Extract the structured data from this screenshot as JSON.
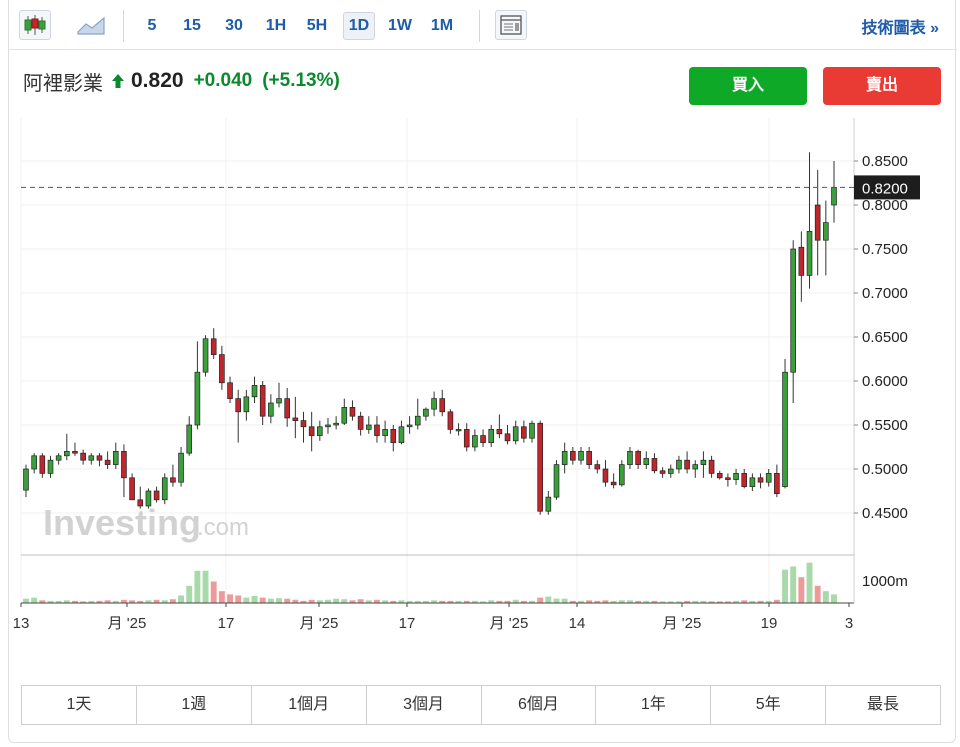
{
  "toolbar": {
    "candlestick_icon": "candlestick-icon",
    "area_icon": "area-chart-icon",
    "intervals": [
      "5",
      "15",
      "30",
      "1H",
      "5H",
      "1D",
      "1W",
      "1M"
    ],
    "active_interval": "1D",
    "layout_icon": "layout-icon",
    "tech_chart_label": "技術圖表 »"
  },
  "instrument": {
    "name": "阿裡影業",
    "price": "0.820",
    "change": "+0.040",
    "change_pct": "(+5.13%)",
    "up_color": "#0a8a2c"
  },
  "actions": {
    "buy_label": "買入",
    "sell_label": "賣出",
    "buy_color": "#0ea926",
    "sell_color": "#ea3a34"
  },
  "chart_data": {
    "type": "candlestick",
    "watermark_main": "Investing",
    "watermark_sub": ".com",
    "y_ticks": [
      "0.8500",
      "0.8000",
      "0.7500",
      "0.7000",
      "0.6500",
      "0.6000",
      "0.5500",
      "0.5000",
      "0.4500"
    ],
    "ylim": [
      0.43,
      0.9
    ],
    "current_price_label": "0.8200",
    "current_price": 0.82,
    "volume_tick_label": "1000m",
    "x_labels": [
      "13",
      "月 '25",
      "17",
      "月 '25",
      "17",
      "月 '25",
      "14",
      "月 '25",
      "19",
      "3"
    ],
    "up_color": "#3aa03a",
    "down_color": "#c0272d",
    "candles": [
      [
        0.476,
        0.505,
        0.468,
        0.5
      ],
      [
        0.5,
        0.518,
        0.495,
        0.515
      ],
      [
        0.515,
        0.518,
        0.49,
        0.495
      ],
      [
        0.495,
        0.515,
        0.49,
        0.51
      ],
      [
        0.51,
        0.518,
        0.505,
        0.515
      ],
      [
        0.515,
        0.54,
        0.51,
        0.52
      ],
      [
        0.52,
        0.53,
        0.515,
        0.518
      ],
      [
        0.518,
        0.522,
        0.505,
        0.51
      ],
      [
        0.51,
        0.518,
        0.505,
        0.515
      ],
      [
        0.515,
        0.518,
        0.503,
        0.51
      ],
      [
        0.51,
        0.52,
        0.5,
        0.505
      ],
      [
        0.505,
        0.53,
        0.5,
        0.52
      ],
      [
        0.52,
        0.528,
        0.468,
        0.49
      ],
      [
        0.49,
        0.495,
        0.465,
        0.465
      ],
      [
        0.465,
        0.48,
        0.455,
        0.458
      ],
      [
        0.458,
        0.478,
        0.455,
        0.475
      ],
      [
        0.475,
        0.48,
        0.462,
        0.465
      ],
      [
        0.465,
        0.495,
        0.46,
        0.49
      ],
      [
        0.49,
        0.505,
        0.48,
        0.485
      ],
      [
        0.485,
        0.525,
        0.48,
        0.518
      ],
      [
        0.518,
        0.56,
        0.515,
        0.55
      ],
      [
        0.55,
        0.645,
        0.545,
        0.61
      ],
      [
        0.61,
        0.652,
        0.605,
        0.648
      ],
      [
        0.648,
        0.66,
        0.625,
        0.63
      ],
      [
        0.63,
        0.64,
        0.59,
        0.598
      ],
      [
        0.598,
        0.605,
        0.575,
        0.58
      ],
      [
        0.58,
        0.59,
        0.53,
        0.565
      ],
      [
        0.565,
        0.59,
        0.555,
        0.582
      ],
      [
        0.582,
        0.605,
        0.575,
        0.595
      ],
      [
        0.595,
        0.6,
        0.55,
        0.56
      ],
      [
        0.56,
        0.585,
        0.552,
        0.575
      ],
      [
        0.575,
        0.598,
        0.57,
        0.58
      ],
      [
        0.58,
        0.592,
        0.548,
        0.558
      ],
      [
        0.558,
        0.582,
        0.535,
        0.555
      ],
      [
        0.555,
        0.565,
        0.53,
        0.548
      ],
      [
        0.548,
        0.565,
        0.52,
        0.538
      ],
      [
        0.538,
        0.555,
        0.532,
        0.548
      ],
      [
        0.548,
        0.558,
        0.54,
        0.55
      ],
      [
        0.55,
        0.56,
        0.545,
        0.552
      ],
      [
        0.552,
        0.58,
        0.55,
        0.57
      ],
      [
        0.57,
        0.578,
        0.555,
        0.56
      ],
      [
        0.56,
        0.565,
        0.538,
        0.545
      ],
      [
        0.545,
        0.56,
        0.54,
        0.55
      ],
      [
        0.55,
        0.56,
        0.53,
        0.538
      ],
      [
        0.538,
        0.555,
        0.53,
        0.545
      ],
      [
        0.545,
        0.55,
        0.52,
        0.53
      ],
      [
        0.53,
        0.555,
        0.528,
        0.548
      ],
      [
        0.548,
        0.56,
        0.54,
        0.55
      ],
      [
        0.55,
        0.58,
        0.545,
        0.56
      ],
      [
        0.56,
        0.57,
        0.555,
        0.568
      ],
      [
        0.568,
        0.588,
        0.56,
        0.58
      ],
      [
        0.58,
        0.59,
        0.56,
        0.565
      ],
      [
        0.565,
        0.568,
        0.54,
        0.545
      ],
      [
        0.545,
        0.552,
        0.538,
        0.545
      ],
      [
        0.545,
        0.552,
        0.52,
        0.525
      ],
      [
        0.525,
        0.545,
        0.52,
        0.538
      ],
      [
        0.538,
        0.545,
        0.525,
        0.53
      ],
      [
        0.53,
        0.55,
        0.525,
        0.545
      ],
      [
        0.545,
        0.562,
        0.535,
        0.54
      ],
      [
        0.54,
        0.55,
        0.528,
        0.532
      ],
      [
        0.532,
        0.555,
        0.528,
        0.548
      ],
      [
        0.548,
        0.555,
        0.53,
        0.535
      ],
      [
        0.535,
        0.555,
        0.53,
        0.552
      ],
      [
        0.552,
        0.555,
        0.448,
        0.452
      ],
      [
        0.452,
        0.475,
        0.448,
        0.468
      ],
      [
        0.468,
        0.51,
        0.465,
        0.505
      ],
      [
        0.505,
        0.53,
        0.495,
        0.52
      ],
      [
        0.52,
        0.525,
        0.505,
        0.51
      ],
      [
        0.51,
        0.525,
        0.505,
        0.52
      ],
      [
        0.52,
        0.525,
        0.5,
        0.505
      ],
      [
        0.505,
        0.51,
        0.495,
        0.5
      ],
      [
        0.5,
        0.51,
        0.48,
        0.485
      ],
      [
        0.485,
        0.495,
        0.478,
        0.482
      ],
      [
        0.482,
        0.51,
        0.48,
        0.505
      ],
      [
        0.505,
        0.525,
        0.5,
        0.52
      ],
      [
        0.52,
        0.522,
        0.5,
        0.505
      ],
      [
        0.505,
        0.52,
        0.5,
        0.512
      ],
      [
        0.512,
        0.518,
        0.495,
        0.498
      ],
      [
        0.498,
        0.502,
        0.49,
        0.495
      ],
      [
        0.495,
        0.505,
        0.49,
        0.5
      ],
      [
        0.5,
        0.515,
        0.495,
        0.51
      ],
      [
        0.51,
        0.52,
        0.495,
        0.5
      ],
      [
        0.5,
        0.51,
        0.49,
        0.505
      ],
      [
        0.505,
        0.52,
        0.49,
        0.51
      ],
      [
        0.51,
        0.515,
        0.49,
        0.495
      ],
      [
        0.495,
        0.498,
        0.488,
        0.49
      ],
      [
        0.49,
        0.495,
        0.48,
        0.488
      ],
      [
        0.488,
        0.5,
        0.482,
        0.495
      ],
      [
        0.495,
        0.5,
        0.478,
        0.48
      ],
      [
        0.48,
        0.495,
        0.475,
        0.49
      ],
      [
        0.49,
        0.495,
        0.478,
        0.485
      ],
      [
        0.485,
        0.5,
        0.48,
        0.495
      ],
      [
        0.495,
        0.505,
        0.468,
        0.472
      ],
      [
        0.48,
        0.625,
        0.478,
        0.61
      ],
      [
        0.61,
        0.76,
        0.575,
        0.75
      ],
      [
        0.752,
        0.77,
        0.69,
        0.72
      ],
      [
        0.72,
        0.86,
        0.705,
        0.77
      ],
      [
        0.8,
        0.84,
        0.72,
        0.76
      ],
      [
        0.76,
        0.805,
        0.72,
        0.78
      ],
      [
        0.8,
        0.85,
        0.78,
        0.82
      ]
    ],
    "volumes": [
      [
        8,
        "u"
      ],
      [
        10,
        "u"
      ],
      [
        5,
        "d"
      ],
      [
        4,
        "u"
      ],
      [
        4,
        "u"
      ],
      [
        5,
        "u"
      ],
      [
        4,
        "d"
      ],
      [
        3,
        "d"
      ],
      [
        4,
        "u"
      ],
      [
        4,
        "d"
      ],
      [
        5,
        "d"
      ],
      [
        4,
        "u"
      ],
      [
        6,
        "d"
      ],
      [
        5,
        "d"
      ],
      [
        4,
        "d"
      ],
      [
        5,
        "u"
      ],
      [
        6,
        "d"
      ],
      [
        5,
        "u"
      ],
      [
        7,
        "d"
      ],
      [
        14,
        "u"
      ],
      [
        32,
        "u"
      ],
      [
        60,
        "u"
      ],
      [
        60,
        "u"
      ],
      [
        40,
        "d"
      ],
      [
        22,
        "d"
      ],
      [
        16,
        "d"
      ],
      [
        14,
        "d"
      ],
      [
        10,
        "u"
      ],
      [
        13,
        "u"
      ],
      [
        10,
        "d"
      ],
      [
        8,
        "u"
      ],
      [
        9,
        "u"
      ],
      [
        8,
        "d"
      ],
      [
        6,
        "d"
      ],
      [
        4,
        "d"
      ],
      [
        6,
        "d"
      ],
      [
        5,
        "u"
      ],
      [
        6,
        "u"
      ],
      [
        8,
        "u"
      ],
      [
        7,
        "u"
      ],
      [
        5,
        "d"
      ],
      [
        7,
        "d"
      ],
      [
        5,
        "u"
      ],
      [
        6,
        "d"
      ],
      [
        5,
        "u"
      ],
      [
        4,
        "d"
      ],
      [
        5,
        "u"
      ],
      [
        4,
        "u"
      ],
      [
        4,
        "u"
      ],
      [
        4,
        "u"
      ],
      [
        5,
        "u"
      ],
      [
        4,
        "d"
      ],
      [
        4,
        "d"
      ],
      [
        4,
        "u"
      ],
      [
        4,
        "d"
      ],
      [
        4,
        "u"
      ],
      [
        3,
        "u"
      ],
      [
        5,
        "u"
      ],
      [
        4,
        "d"
      ],
      [
        4,
        "d"
      ],
      [
        6,
        "u"
      ],
      [
        4,
        "d"
      ],
      [
        4,
        "u"
      ],
      [
        10,
        "d"
      ],
      [
        12,
        "u"
      ],
      [
        8,
        "u"
      ],
      [
        8,
        "u"
      ],
      [
        4,
        "d"
      ],
      [
        4,
        "u"
      ],
      [
        5,
        "d"
      ],
      [
        4,
        "d"
      ],
      [
        5,
        "d"
      ],
      [
        4,
        "u"
      ],
      [
        5,
        "u"
      ],
      [
        5,
        "u"
      ],
      [
        4,
        "d"
      ],
      [
        4,
        "u"
      ],
      [
        4,
        "d"
      ],
      [
        3,
        "u"
      ],
      [
        3,
        "u"
      ],
      [
        3,
        "u"
      ],
      [
        4,
        "d"
      ],
      [
        4,
        "u"
      ],
      [
        4,
        "u"
      ],
      [
        3,
        "d"
      ],
      [
        3,
        "d"
      ],
      [
        3,
        "d"
      ],
      [
        4,
        "u"
      ],
      [
        5,
        "d"
      ],
      [
        4,
        "u"
      ],
      [
        4,
        "d"
      ],
      [
        4,
        "u"
      ],
      [
        6,
        "d"
      ],
      [
        62,
        "u"
      ],
      [
        68,
        "u"
      ],
      [
        48,
        "d"
      ],
      [
        75,
        "u"
      ],
      [
        32,
        "d"
      ],
      [
        22,
        "u"
      ],
      [
        16,
        "u"
      ]
    ]
  },
  "periods": [
    "1天",
    "1週",
    "1個月",
    "3個月",
    "6個月",
    "1年",
    "5年",
    "最長"
  ]
}
